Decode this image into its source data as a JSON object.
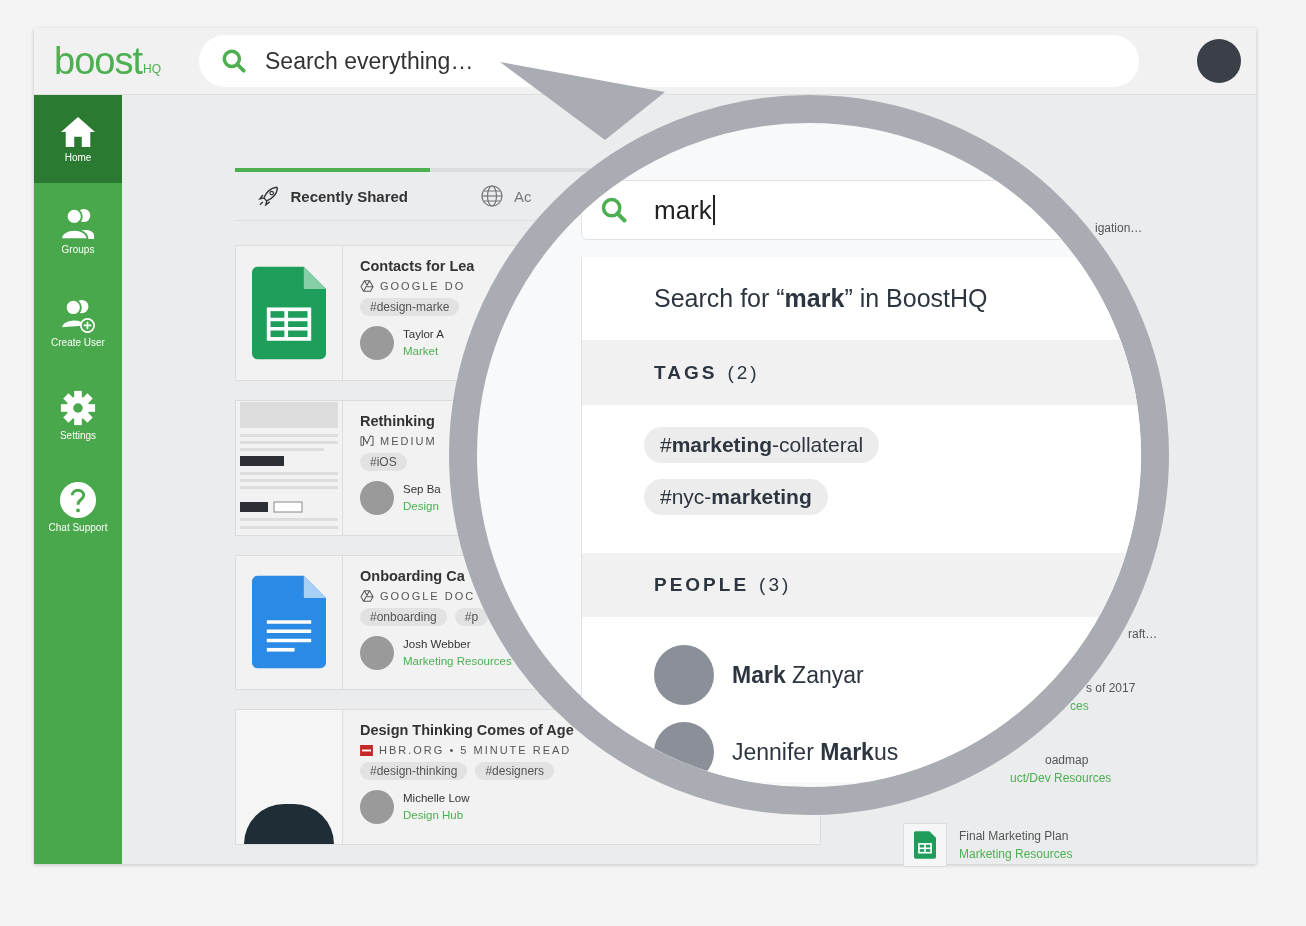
{
  "brand": {
    "name": "boost",
    "suffix": "HQ"
  },
  "search": {
    "placeholder": "Search everything…"
  },
  "sidebar": {
    "items": [
      {
        "label": "Home",
        "selected": true
      },
      {
        "label": "Groups",
        "selected": false
      },
      {
        "label": "Create User",
        "selected": false
      },
      {
        "label": "Settings",
        "selected": false
      },
      {
        "label": "Chat Support",
        "selected": false
      }
    ]
  },
  "tabs": [
    {
      "label": "Recently Shared",
      "selected": true
    },
    {
      "label": "Ac",
      "selected": false
    }
  ],
  "cards": [
    {
      "title": "Contacts for Lea",
      "source": "GOOGLE DO",
      "tags": [
        "#design-marke"
      ],
      "person": "Taylor A",
      "group": "Market"
    },
    {
      "title": "Rethinking",
      "source": "MEDIUM",
      "tags": [
        "#iOS"
      ],
      "person": "Sep Ba",
      "group": "Design"
    },
    {
      "title": "Onboarding Ca",
      "source": "GOOGLE DOC",
      "tags": [
        "#onboarding",
        "#p"
      ],
      "person": "Josh Webber",
      "group": "Marketing Resources"
    },
    {
      "title": "Design Thinking Comes of Age",
      "source": "HBR.ORG • 5 MINUTE READ",
      "tags": [
        "#design-thinking",
        "#designers"
      ],
      "person": "Michelle Low",
      "group": "Design Hub"
    }
  ],
  "side_items": [
    {
      "title": "igation…"
    },
    {
      "title": "raft…"
    },
    {
      "title": "s of 2017",
      "group": "ces"
    },
    {
      "title": "oadmap",
      "group": "uct/Dev Resources"
    },
    {
      "title": "Final Marketing Plan",
      "group": "Marketing Resources"
    }
  ],
  "magnifier": {
    "query": "mark",
    "suggestion": "Search for “**mark**” in BoostHQ",
    "sections": [
      {
        "kind": "tags",
        "title": "TAGS",
        "count": "(2)",
        "items": [
          "#**marketing**-collateral",
          "#nyc-**marketing**"
        ]
      },
      {
        "kind": "people",
        "title": "PEOPLE",
        "count": "(3)",
        "items": [
          "**Mark** Zanyar",
          "Jennifer **Mark**us"
        ]
      }
    ]
  }
}
